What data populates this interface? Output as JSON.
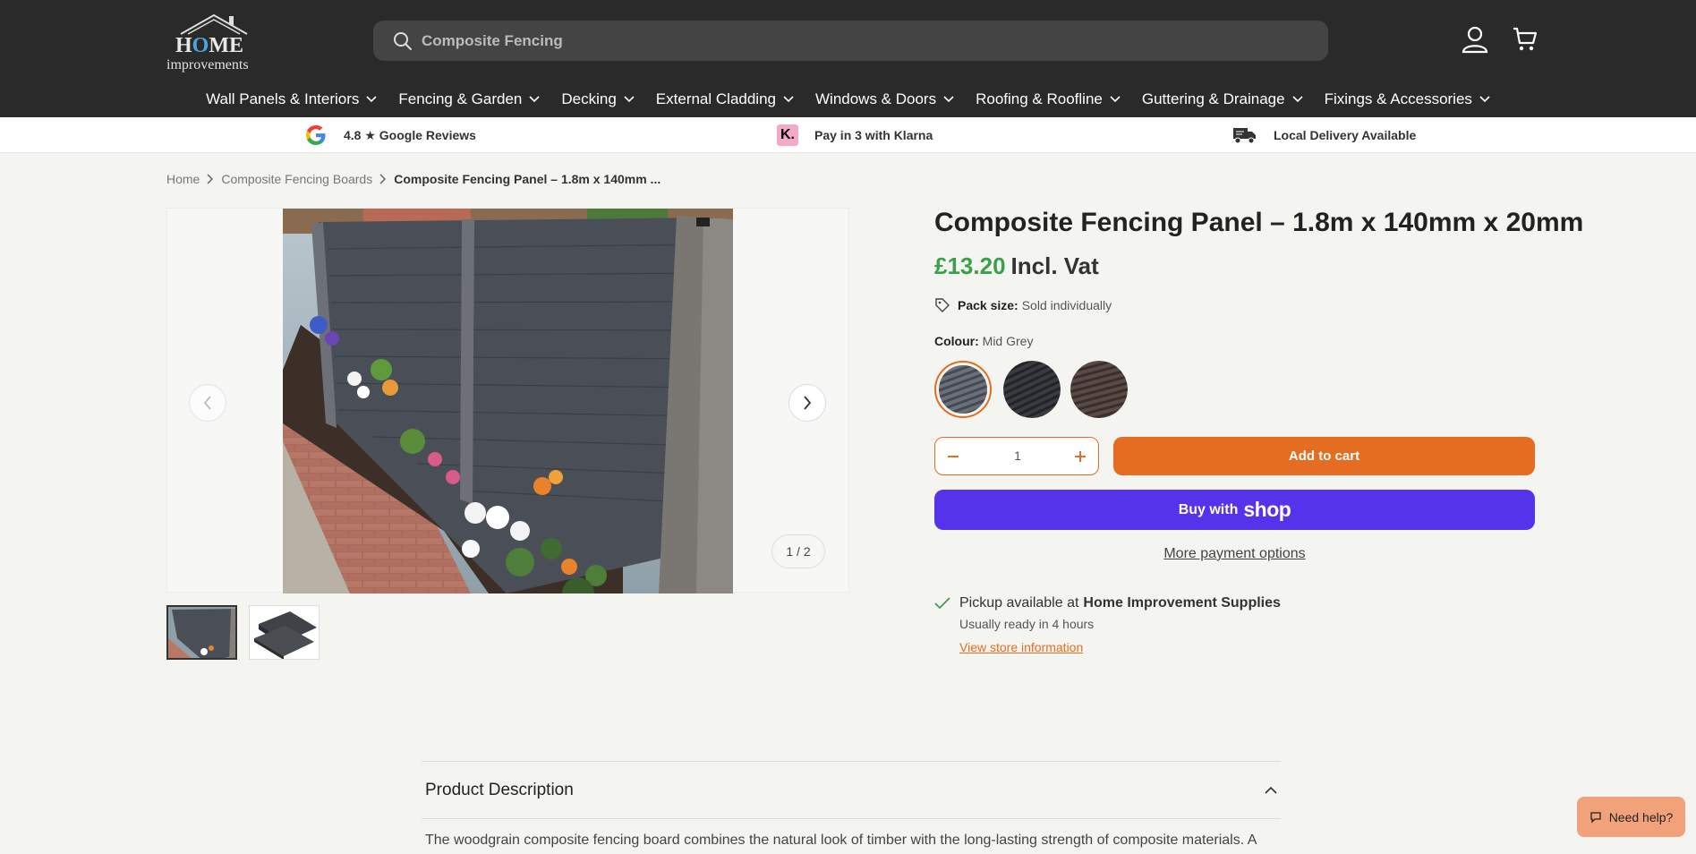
{
  "header": {
    "logo_top": "H",
    "logo_o": "O",
    "logo_rest": "ME",
    "logo_bottom": "improvements",
    "search_value": "Composite Fencing"
  },
  "nav": [
    {
      "label": "Wall Panels & Interiors"
    },
    {
      "label": "Fencing & Garden"
    },
    {
      "label": "Decking"
    },
    {
      "label": "External Cladding"
    },
    {
      "label": "Windows & Doors"
    },
    {
      "label": "Roofing & Roofline"
    },
    {
      "label": "Guttering & Drainage"
    },
    {
      "label": "Fixings & Accessories"
    }
  ],
  "usp": {
    "reviews": "4.8 ★ Google Reviews",
    "klarna_badge": "K.",
    "klarna": "Pay in 3 with Klarna",
    "delivery": "Local Delivery Available"
  },
  "breadcrumb": {
    "home": "Home",
    "category": "Composite Fencing Boards",
    "current": "Composite Fencing Panel – 1.8m x 140mm ..."
  },
  "gallery": {
    "counter": "1 / 2"
  },
  "product": {
    "title": "Composite Fencing Panel – 1.8m x 140mm x 20mm",
    "price": "£13.20",
    "price_suffix": "Incl. Vat",
    "pack_label": "Pack size:",
    "pack_value": "Sold individually",
    "colour_label": "Colour:",
    "colour_value": "Mid Grey",
    "swatch_colors": [
      "#5a6068",
      "#2e2f33",
      "#4a3c38"
    ],
    "quantity": "1",
    "add_to_cart": "Add to cart",
    "buy_with": "Buy with",
    "shop_logo": "shop",
    "more_payment": "More payment options"
  },
  "pickup": {
    "prefix": "Pickup available at",
    "store": "Home Improvement Supplies",
    "ready": "Usually ready in 4 hours",
    "link": "View store information"
  },
  "description": {
    "heading": "Product Description",
    "body": "The woodgrain composite fencing board combines the natural look of timber with the long-lasting strength of composite materials. A deep grain finish replicates real wood while removing the need for ongoing maintenance. Unlike traditional"
  },
  "help": {
    "label": "Need help?"
  },
  "colors": {
    "accent": "#e46d22",
    "price_green": "#3aa04a",
    "shop_purple": "#5433eb",
    "header_bg": "#2a2a2a"
  }
}
